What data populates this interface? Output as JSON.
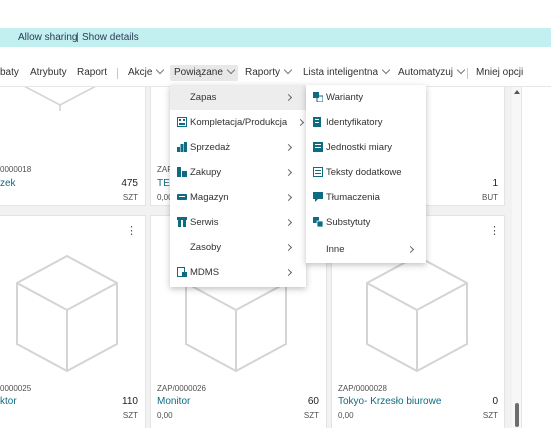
{
  "banner": {
    "allow_sharing": "Allow sharing",
    "divider": "|",
    "show_details": "Show details"
  },
  "actionbar": {
    "items": [
      "baty",
      "Atrybuty",
      "Raport",
      "Akcje",
      "Powiązane",
      "Raporty",
      "Lista inteligentna",
      "Automatyzuj",
      "Mniej opcji"
    ]
  },
  "cards": [
    {
      "code": "0000018",
      "name": "zek",
      "qty": "475",
      "unit": "SZT",
      "price": ""
    },
    {
      "code": "ZAP",
      "name": "TE",
      "qty": "",
      "unit": "",
      "price": "0,00"
    },
    {
      "code": "",
      "name": "",
      "qty": "1",
      "unit": "BUT",
      "price": ""
    },
    {
      "code": "0000025",
      "name": "ktor",
      "qty": "110",
      "unit": "SZT",
      "price": ""
    },
    {
      "code": "ZAP/0000026",
      "name": "Monitor",
      "qty": "60",
      "unit": "SZT",
      "price": "0,00"
    },
    {
      "code": "ZAP/0000028",
      "name": "Tokyo- Krzesło biurowe",
      "qty": "0",
      "unit": "SZT",
      "price": "0,00"
    }
  ],
  "menu_main": [
    {
      "label": "Zapas",
      "icon": "none",
      "submenu": true
    },
    {
      "label": "Kompletacja/Produkcja",
      "icon": "assembly-icon",
      "submenu": true
    },
    {
      "label": "Sprzedaż",
      "icon": "sales-icon",
      "submenu": true
    },
    {
      "label": "Zakupy",
      "icon": "purchase-icon",
      "submenu": true
    },
    {
      "label": "Magazyn",
      "icon": "warehouse-icon",
      "submenu": true
    },
    {
      "label": "Serwis",
      "icon": "service-icon",
      "submenu": true
    },
    {
      "label": "Zasoby",
      "icon": "none",
      "submenu": true
    },
    {
      "label": "MDMS",
      "icon": "mdms-icon",
      "submenu": true
    }
  ],
  "menu_sub": [
    {
      "label": "Warianty",
      "icon": "variants-icon"
    },
    {
      "label": "Identyfikatory",
      "icon": "identifiers-icon"
    },
    {
      "label": "Jednostki miary",
      "icon": "units-icon"
    },
    {
      "label": "Teksty dodatkowe",
      "icon": "texts-icon"
    },
    {
      "label": "Tłumaczenia",
      "icon": "translations-icon"
    },
    {
      "label": "Substytuty",
      "icon": "substitutes-icon"
    },
    {
      "label": "Inne",
      "icon": "none"
    }
  ],
  "colors": {
    "banner": "#c2eff0",
    "link": "#0e6b82",
    "accent": "#008489"
  }
}
